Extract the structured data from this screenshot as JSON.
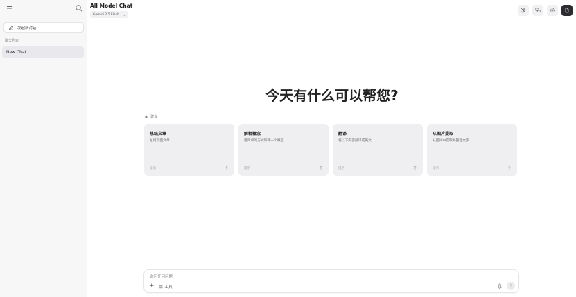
{
  "sidebar": {
    "new_chat_label": "发起新对话",
    "history_label": "聊天列表",
    "items": [
      {
        "label": "New Chat"
      }
    ]
  },
  "header": {
    "title": "All Model Chat",
    "model": "Gemini 2.5 Flash"
  },
  "main": {
    "greeting": "今天有什么可以帮您?",
    "suggestions_label": "建议",
    "cards": [
      {
        "title": "总结文章",
        "desc": "总结下面文章",
        "footer": "提示"
      },
      {
        "title": "解释概念",
        "desc": "用简单的方式解释一个概念",
        "footer": "提示"
      },
      {
        "title": "翻译",
        "desc": "将以下内容翻译成英文",
        "footer": "提示"
      },
      {
        "title": "从图片提取",
        "desc": "从图片中提取并整理文字",
        "footer": "提示"
      }
    ]
  },
  "input": {
    "placeholder": "询问任何问题",
    "tools_label": "工具"
  }
}
